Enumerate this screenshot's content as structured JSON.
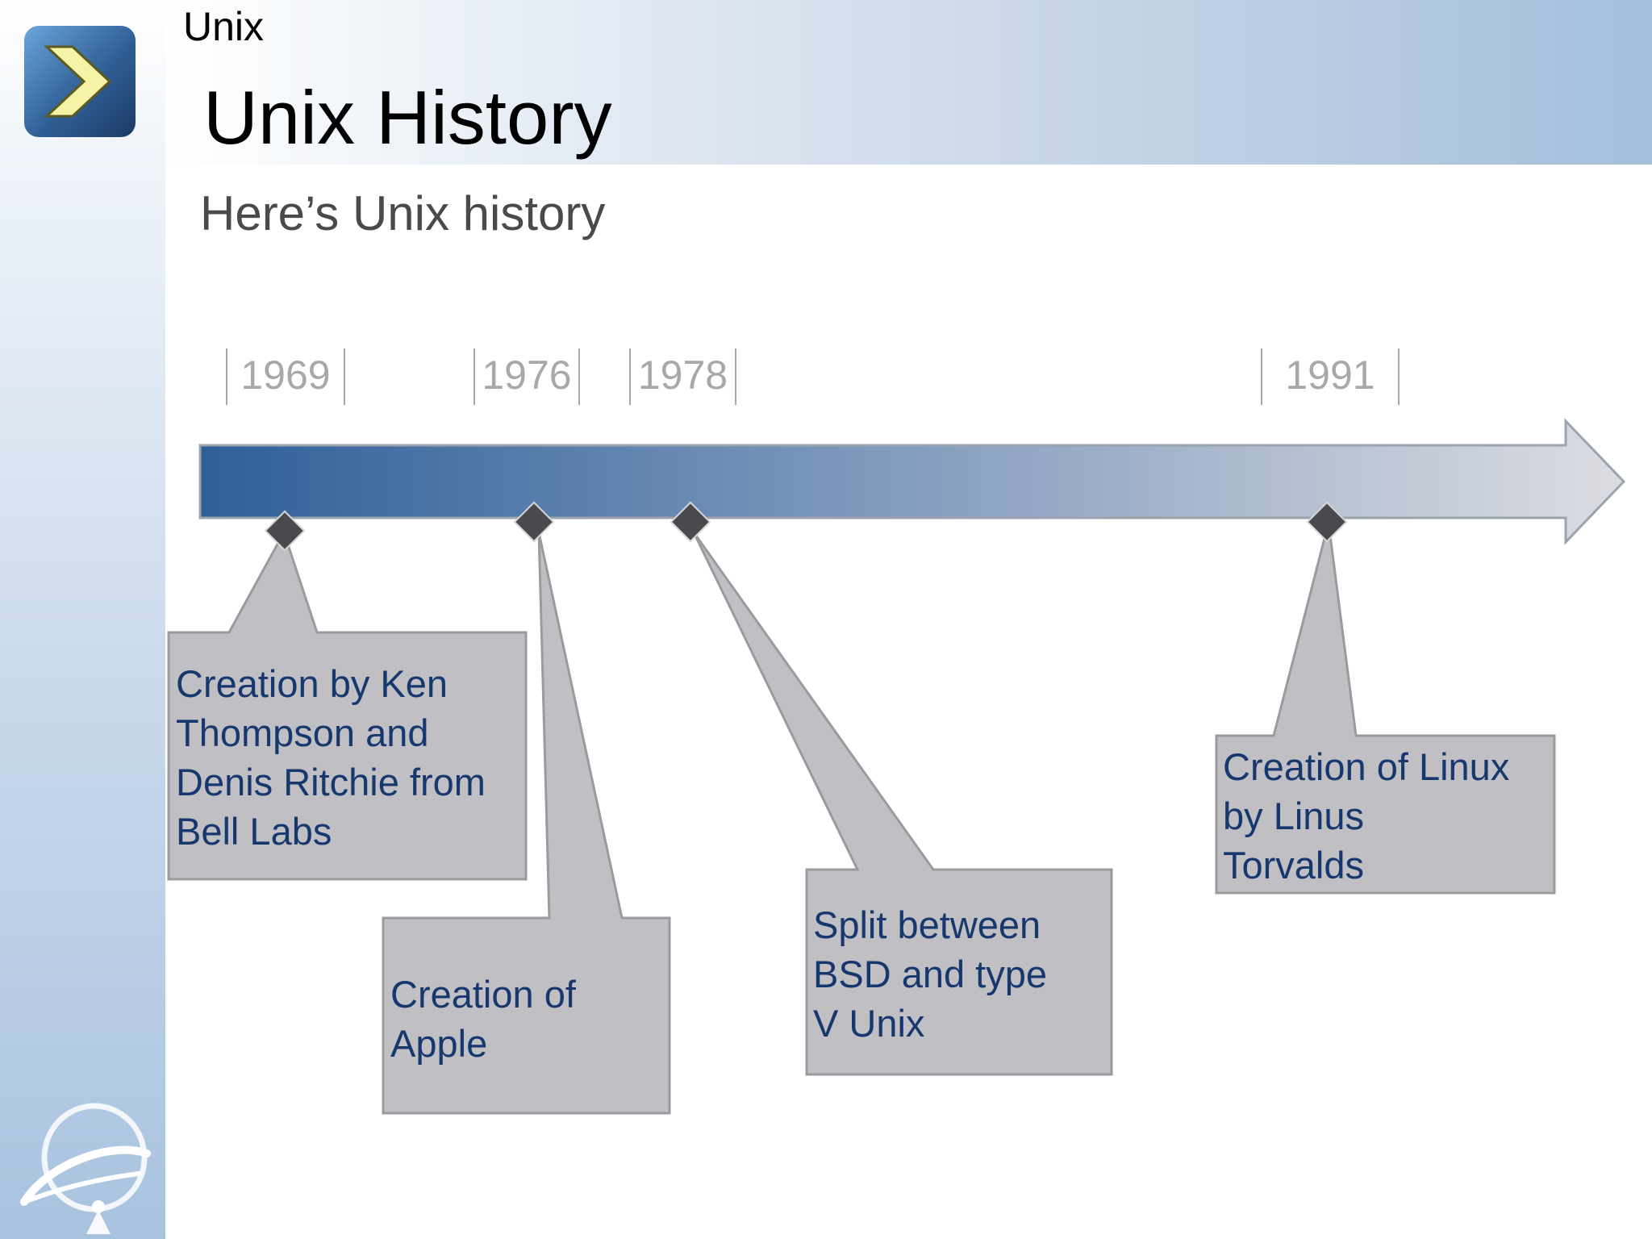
{
  "header": {
    "section_label": "Unix",
    "title": "Unix History",
    "subtitle": "Here’s Unix history"
  },
  "colors": {
    "timeline_start": "#2e5f98",
    "timeline_end": "#dcdde2",
    "callout_fill": "#c0bfc3",
    "callout_text": "#17386e",
    "year_label": "#a8a8a8"
  },
  "icons": [
    "chevron-right-icon",
    "orbit-logo-icon"
  ],
  "timeline": {
    "years": [
      {
        "label": "1969"
      },
      {
        "label": "1976"
      },
      {
        "label": "1978"
      },
      {
        "label": "1991"
      }
    ],
    "events": [
      {
        "year": "1969",
        "text_lines": [
          "Creation by Ken",
          "Thompson and",
          "Denis Ritchie from",
          "Bell Labs"
        ]
      },
      {
        "year": "1976",
        "text_lines": [
          "Creation of",
          "Apple"
        ]
      },
      {
        "year": "1978",
        "text_lines": [
          "Split between",
          "BSD and type",
          "V Unix"
        ]
      },
      {
        "year": "1991",
        "text_lines": [
          "Creation of Linux",
          "by Linus",
          "Torvalds"
        ]
      }
    ]
  }
}
